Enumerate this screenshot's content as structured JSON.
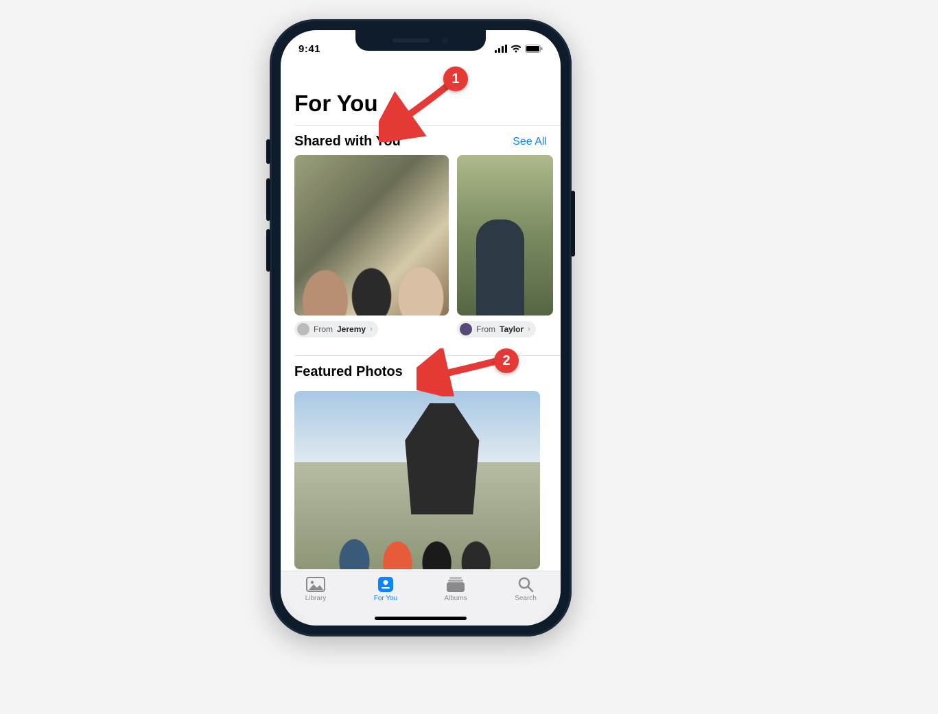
{
  "status": {
    "time": "9:41"
  },
  "page": {
    "title": "For You"
  },
  "shared": {
    "title": "Shared with You",
    "see_all": "See All",
    "items": [
      {
        "from_prefix": "From ",
        "from_name": "Jeremy"
      },
      {
        "from_prefix": "From ",
        "from_name": "Taylor"
      }
    ]
  },
  "featured": {
    "title": "Featured Photos"
  },
  "tabs": {
    "library": "Library",
    "for_you": "For You",
    "albums": "Albums",
    "search": "Search"
  },
  "annotations": {
    "a1": "1",
    "a2": "2"
  }
}
